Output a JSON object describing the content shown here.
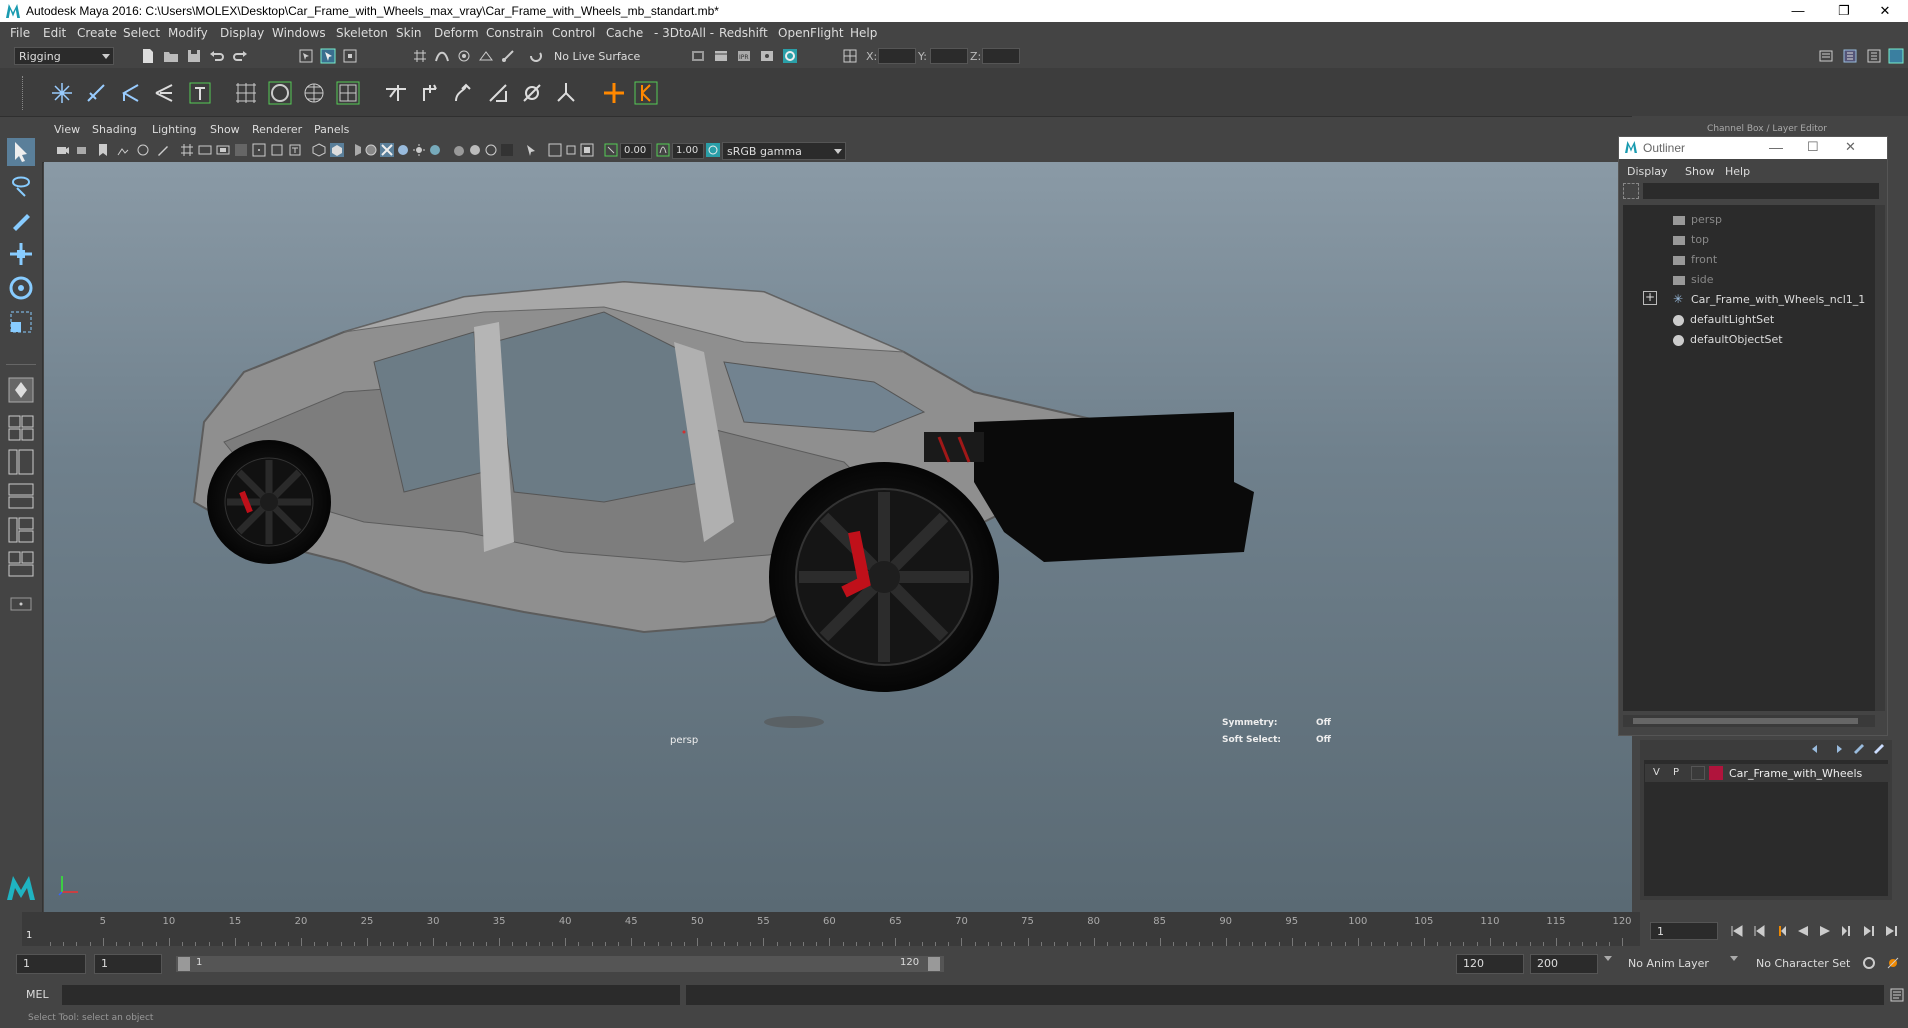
{
  "window": {
    "title": "Autodesk Maya 2016: C:\\Users\\MOLEX\\Desktop\\Car_Frame_with_Wheels_max_vray\\Car_Frame_with_Wheels_mb_standart.mb*",
    "minimize": "—",
    "restore": "❐",
    "close": "✕"
  },
  "menubar": [
    "File",
    "Edit",
    "Create",
    "Select",
    "Modify",
    "Display",
    "Windows",
    "Skeleton",
    "Skin",
    "Deform",
    "Constrain",
    "Control",
    "Cache",
    "- 3DtoAll -",
    "Redshift",
    "OpenFlight",
    "Help"
  ],
  "status": {
    "mode": "Rigging",
    "live_surface": "No Live Surface",
    "x_label": "X:",
    "y_label": "Y:",
    "z_label": "Z:"
  },
  "panel_menu": [
    "View",
    "Shading",
    "Lighting",
    "Show",
    "Renderer",
    "Panels"
  ],
  "panel_tools": {
    "near_value": "0.00",
    "far_value": "1.00",
    "color_space": "sRGB gamma"
  },
  "viewport": {
    "camera_label": "persp",
    "symmetry_label": "Symmetry:",
    "symmetry_value": "Off",
    "soft_select_label": "Soft Select:",
    "soft_select_value": "Off"
  },
  "channel_box": {
    "title": "Channel Box / Layer Editor"
  },
  "outliner": {
    "title": "Outliner",
    "menu": [
      "Display",
      "Show",
      "Help"
    ],
    "items": [
      {
        "label": "persp",
        "kind": "camera",
        "dim": true
      },
      {
        "label": "top",
        "kind": "camera",
        "dim": true
      },
      {
        "label": "front",
        "kind": "camera",
        "dim": true
      },
      {
        "label": "side",
        "kind": "camera",
        "dim": true
      },
      {
        "label": "Car_Frame_with_Wheels_ncl1_1",
        "kind": "group",
        "dim": false
      },
      {
        "label": "defaultLightSet",
        "kind": "set",
        "dim": false
      },
      {
        "label": "defaultObjectSet",
        "kind": "set",
        "dim": false
      }
    ]
  },
  "layers": {
    "row": {
      "v": "V",
      "p": "P",
      "name": "Car_Frame_with_Wheels",
      "color": "#b0143c"
    }
  },
  "timeline": {
    "ticks": [
      "5",
      "10",
      "15",
      "20",
      "25",
      "30",
      "35",
      "40",
      "45",
      "50",
      "55",
      "60",
      "65",
      "70",
      "75",
      "80",
      "85",
      "90",
      "95",
      "100",
      "105",
      "110",
      "115",
      "120"
    ],
    "start_marker": "1",
    "current_frame": "1"
  },
  "range": {
    "start": "1",
    "range_start": "1",
    "slider_start": "1",
    "slider_end": "120",
    "range_end": "120",
    "end": "200",
    "anim_layer": "No Anim Layer",
    "character_set": "No Character Set"
  },
  "cmdline": {
    "label": "MEL"
  },
  "helpline": {
    "text": "Select Tool: select an object"
  }
}
